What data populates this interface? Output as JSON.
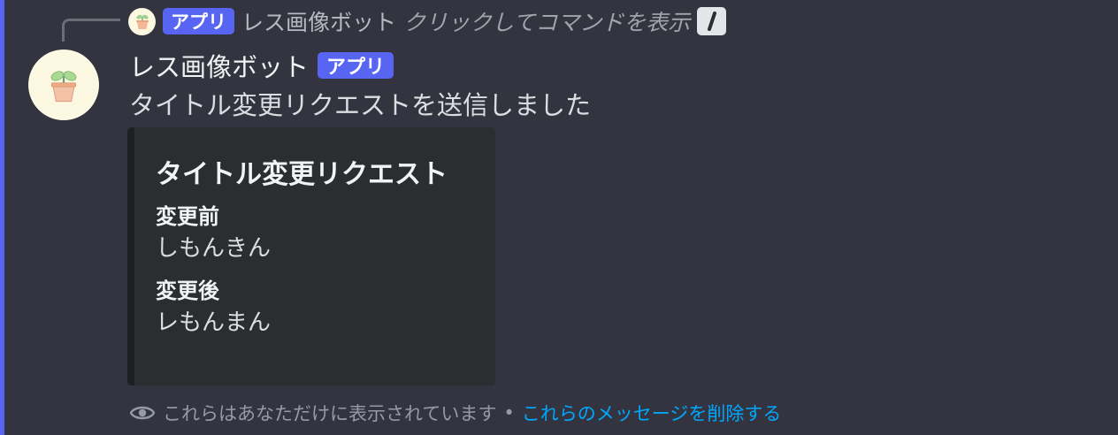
{
  "reply": {
    "bot_name": "レス画像ボット",
    "tag": "アプリ",
    "command_hint": "クリックしてコマンドを表示",
    "icon": "slash-command-icon"
  },
  "message": {
    "bot_name": "レス画像ボット",
    "tag": "アプリ",
    "text": "タイトル変更リクエストを送信しました",
    "avatar_icon": "potted-plant-icon"
  },
  "embed": {
    "title": "タイトル変更リクエスト",
    "fields": [
      {
        "name": "変更前",
        "value": "しもんきん"
      },
      {
        "name": "変更後",
        "value": "レもんまん"
      }
    ]
  },
  "footer": {
    "icon": "eye-icon",
    "note": "これらはあなただけに表示されています",
    "separator": "•",
    "dismiss_link": "これらのメッセージを削除する"
  },
  "colors": {
    "background": "#33343f",
    "accent": "#5865f2",
    "link": "#00a8fc",
    "embed_bg": "#2b2d31"
  }
}
